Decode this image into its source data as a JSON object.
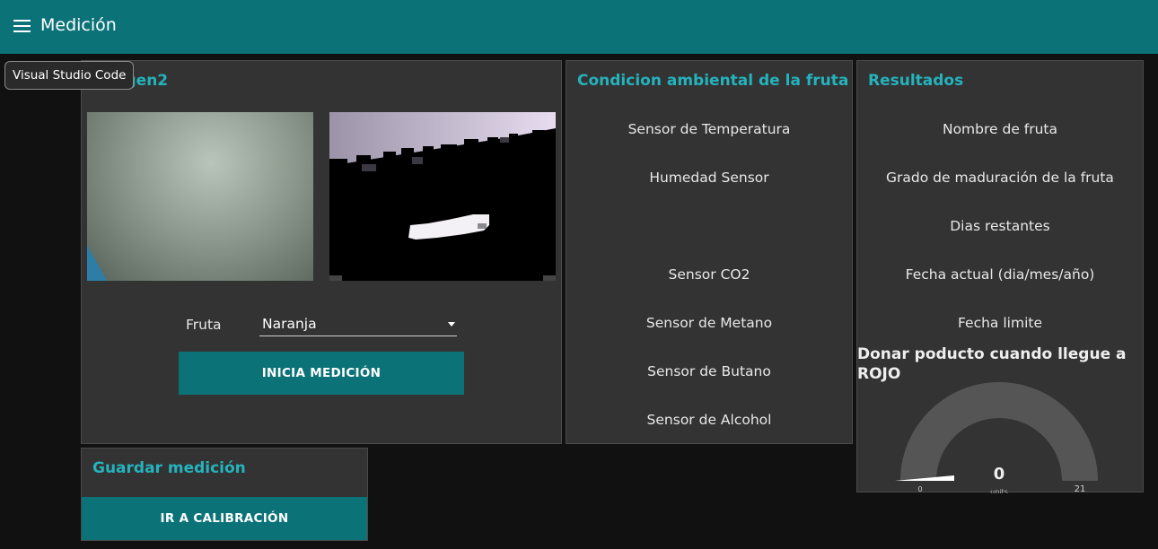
{
  "header": {
    "menu_icon": "menu-icon",
    "title": "Medición"
  },
  "tooltip": {
    "text": "Visual Studio Code"
  },
  "panel_imagen": {
    "title": "Imagen2",
    "fruit_label": "Fruta",
    "fruit_select": {
      "value": "Naranja"
    },
    "start_button": "INICIA MEDICIÓN"
  },
  "panel_condicion": {
    "title": "Condicion ambiental de la fruta",
    "sensors": [
      "Sensor de Temperatura",
      "Humedad Sensor",
      "Sensor CO2",
      "Sensor de Metano",
      "Sensor de Butano",
      "Sensor de Alcohol"
    ]
  },
  "panel_resultados": {
    "title": "Resultados",
    "items": [
      "Nombre de fruta",
      "Grado de maduración de la fruta",
      "Dias restantes",
      "Fecha actual (dia/mes/año)",
      "Fecha limite"
    ],
    "gauge": {
      "title": "Donar poducto cuando llegue a ROJO",
      "value": "0",
      "units": "units",
      "min": "0",
      "max": "21",
      "level": 0,
      "color_track": "#555555",
      "color_needle": "#ffffff"
    }
  },
  "panel_guardar": {
    "title": "Guardar medición",
    "button": "IR A CALIBRACIÓN"
  },
  "colors": {
    "accent": "#0b7378",
    "title_teal": "#24b3bd",
    "panel": "#333333",
    "background": "#111111"
  }
}
